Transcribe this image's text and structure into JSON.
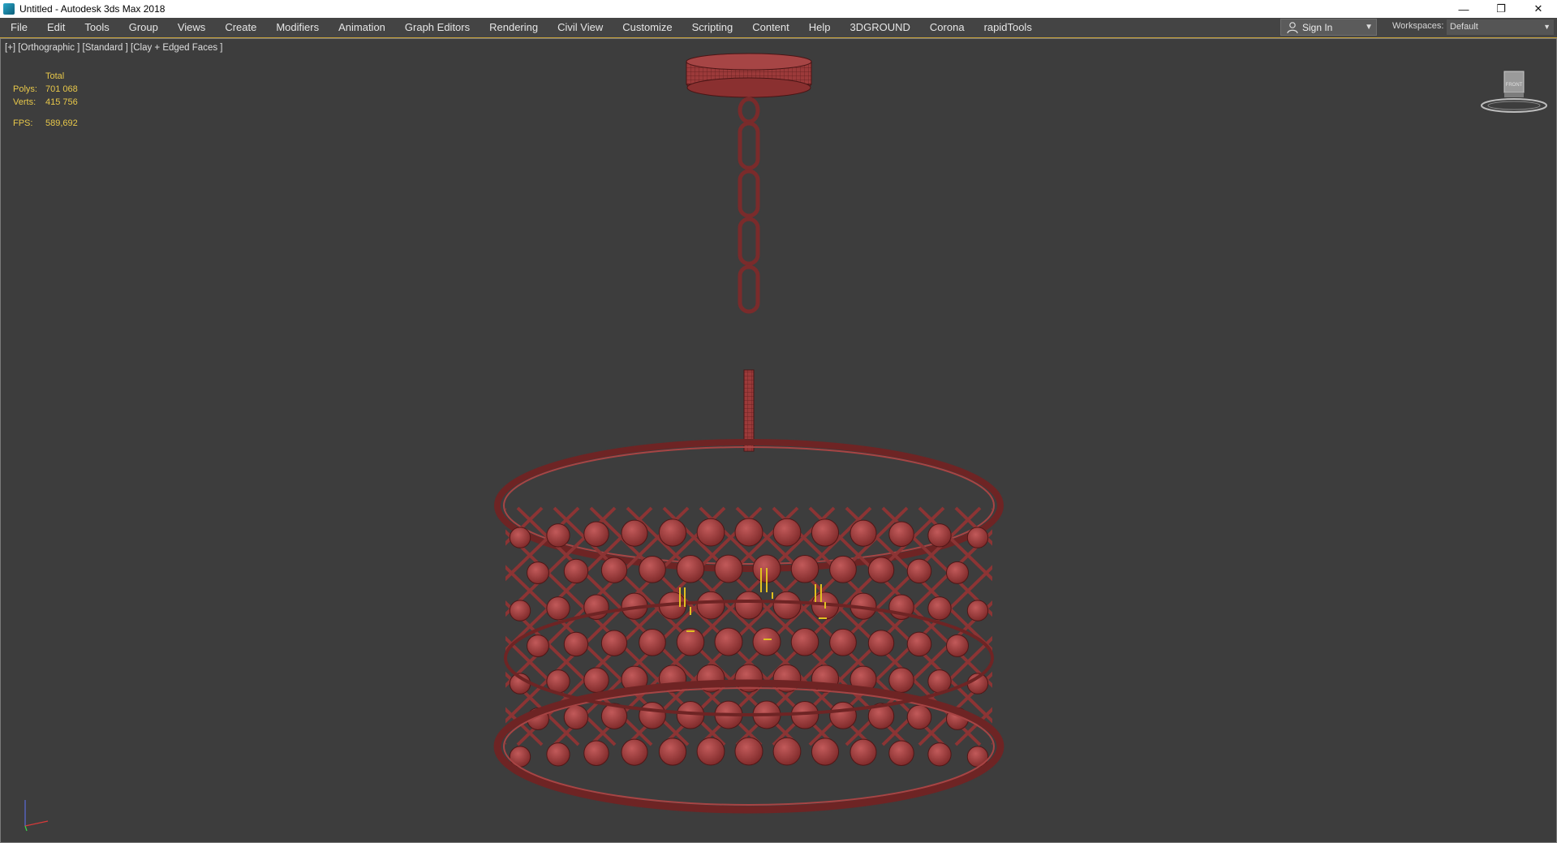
{
  "window": {
    "title": "Untitled - Autodesk 3ds Max 2018",
    "controls": [
      "—",
      "❐",
      "✕"
    ]
  },
  "menu": [
    "File",
    "Edit",
    "Tools",
    "Group",
    "Views",
    "Create",
    "Modifiers",
    "Animation",
    "Graph Editors",
    "Rendering",
    "Civil View",
    "Customize",
    "Scripting",
    "Content",
    "Help",
    "3DGROUND",
    "Corona",
    "rapidTools"
  ],
  "account": {
    "signin_label": "Sign In"
  },
  "workspaces": {
    "label": "Workspaces:",
    "value": "Default"
  },
  "viewport": {
    "label": "[+] [Orthographic ] [Standard ] [Clay + Edged Faces ]",
    "stats": {
      "header": "Total",
      "polys_label": "Polys:",
      "polys_value": "701 068",
      "verts_label": "Verts:",
      "verts_value": "415 756",
      "fps_label": "FPS:",
      "fps_value": "589,692"
    },
    "viewcube_face": "FRONT"
  },
  "colors": {
    "viewport_bg": "#3d3d3d",
    "model_fill": "#a03c3c",
    "model_wire": "#5a1a1a",
    "stats_text": "#e8c84a",
    "accent": "#c8a23a"
  }
}
